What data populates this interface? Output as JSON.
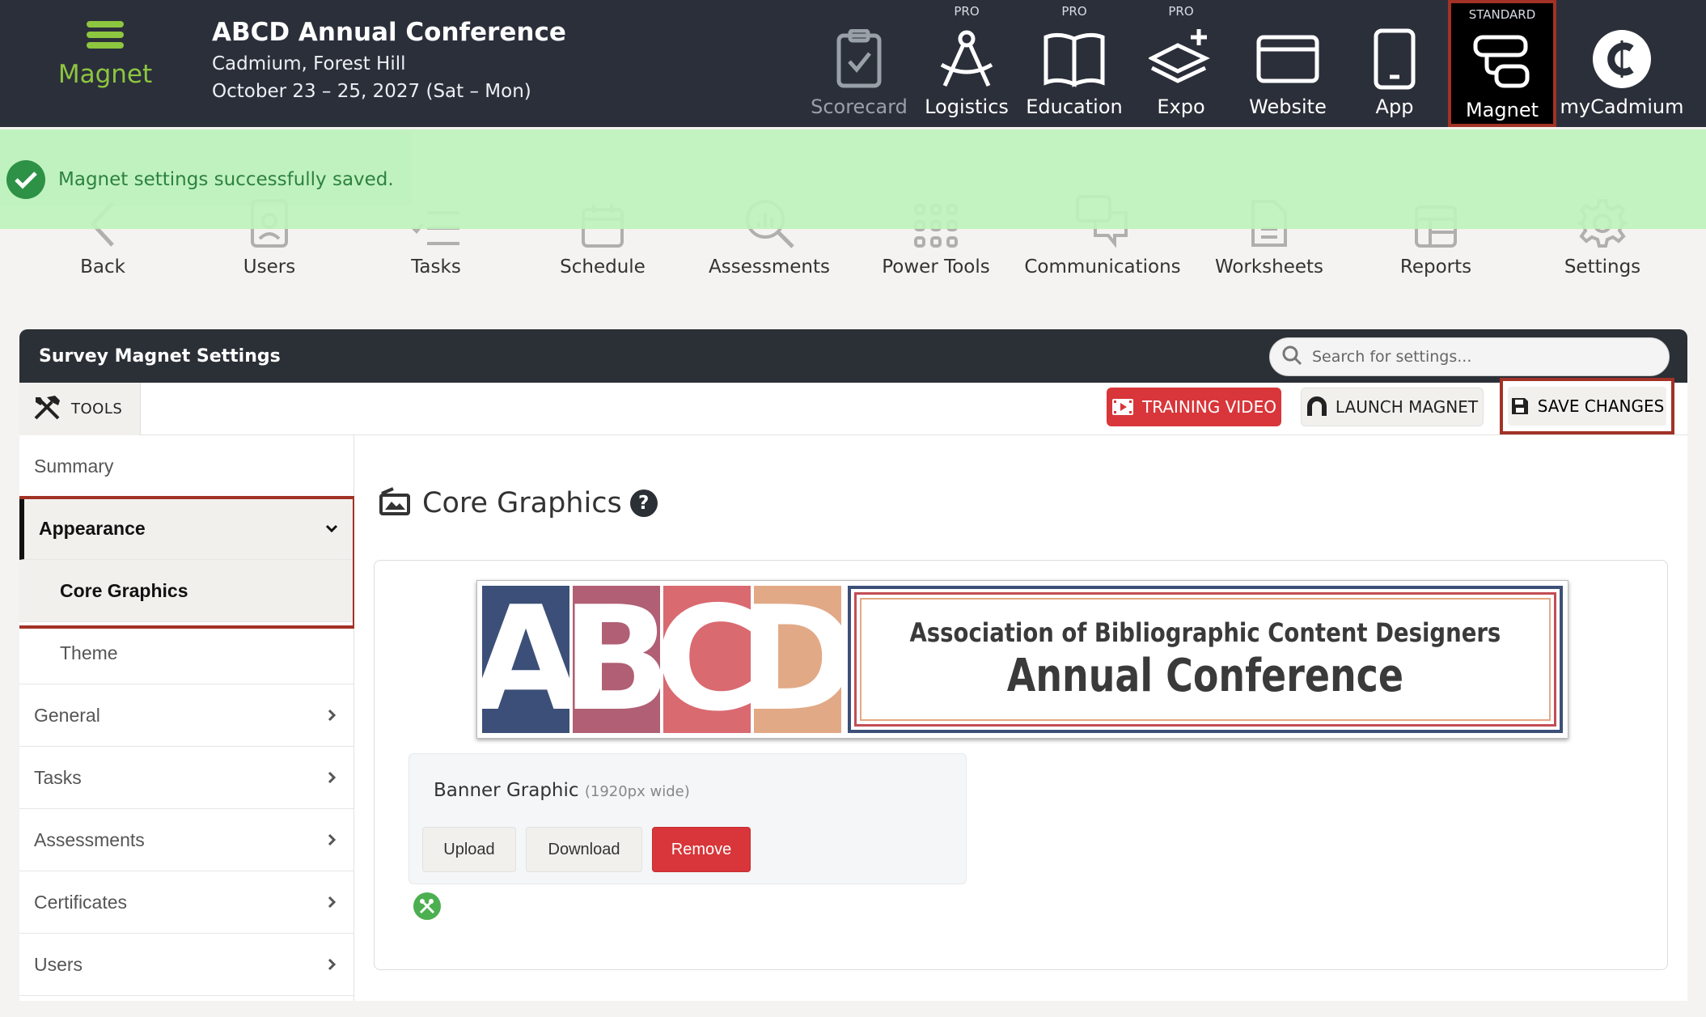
{
  "app": {
    "logo_text": "Magnet",
    "conference_title": "ABCD Annual Conference",
    "location": "Cadmium, Forest Hill",
    "dates": "October 23 – 25, 2027 (Sat – Mon)"
  },
  "modules": [
    {
      "label": "Scorecard",
      "tier": "",
      "icon": "clipboard-check-icon"
    },
    {
      "label": "Logistics",
      "tier": "PRO",
      "icon": "compass-icon"
    },
    {
      "label": "Education",
      "tier": "PRO",
      "icon": "book-icon"
    },
    {
      "label": "Expo",
      "tier": "PRO",
      "icon": "layers-plus-icon"
    },
    {
      "label": "Website",
      "tier": "",
      "icon": "browser-window-icon"
    },
    {
      "label": "App",
      "tier": "",
      "icon": "phone-icon"
    },
    {
      "label": "Magnet",
      "tier": "STANDARD",
      "icon": "magnet-module-icon"
    },
    {
      "label": "myCadmium",
      "tier": "",
      "icon": "cadmium-logo-icon"
    }
  ],
  "toolbar": {
    "items": [
      "Back",
      "Users",
      "Tasks",
      "Schedule",
      "Assessments",
      "Power Tools",
      "Communications",
      "Worksheets",
      "Reports",
      "Settings"
    ]
  },
  "toast": {
    "message": "Magnet settings successfully saved."
  },
  "panel": {
    "title": "Survey Magnet Settings",
    "search_placeholder": "Search for settings...",
    "tools_label": "TOOLS",
    "training_label": "TRAINING VIDEO",
    "launch_label": "LAUNCH MAGNET",
    "save_label": "SAVE CHANGES"
  },
  "sidebar": {
    "summary": "Summary",
    "appearance": "Appearance",
    "core_graphics": "Core Graphics",
    "theme": "Theme",
    "general": "General",
    "tasks": "Tasks",
    "assessments": "Assessments",
    "certificates": "Certificates",
    "users": "Users"
  },
  "main": {
    "section_title": "Core Graphics",
    "help": "?",
    "banner": {
      "letters": [
        "A",
        "B",
        "C",
        "D"
      ],
      "letter_colors": [
        "#3c4f78",
        "#b05f74",
        "#d96a70",
        "#e2a987"
      ],
      "line1": "Association of Bibliographic Content Designers",
      "line2": "Annual Conference"
    },
    "banner_graphic_label": "Banner Graphic",
    "banner_graphic_hint": "(1920px wide)",
    "upload_label": "Upload",
    "download_label": "Download",
    "remove_label": "Remove"
  },
  "colors": {
    "header_bg": "#2b2f3a",
    "accent_green": "#8dc63f",
    "highlight_border": "#a23226",
    "toast_bg": "#bdf2bc",
    "danger": "#d8363a"
  }
}
